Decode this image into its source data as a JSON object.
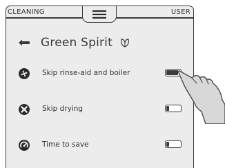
{
  "header": {
    "left_label": "CLEANING",
    "right_label": "USER",
    "menu_icon": "hamburger-menu-icon"
  },
  "title": {
    "back_icon": "arrow-left-icon",
    "text": "Green Spirit",
    "leaf_icon": "leaf-icon"
  },
  "options": [
    {
      "label": "Skip rinse-aid and boiler",
      "icon": "rinse-aid-skip-icon",
      "toggle_on": true
    },
    {
      "label": "Skip drying",
      "icon": "skip-drying-icon",
      "toggle_on": false
    },
    {
      "label": "Time to save",
      "icon": "time-to-save-icon",
      "toggle_on": false
    }
  ],
  "pointer": {
    "icon": "pointing-hand-icon"
  },
  "colors": {
    "background": "#ececec",
    "foreground": "#3a3a3a",
    "hand": "#d8d8d8"
  }
}
